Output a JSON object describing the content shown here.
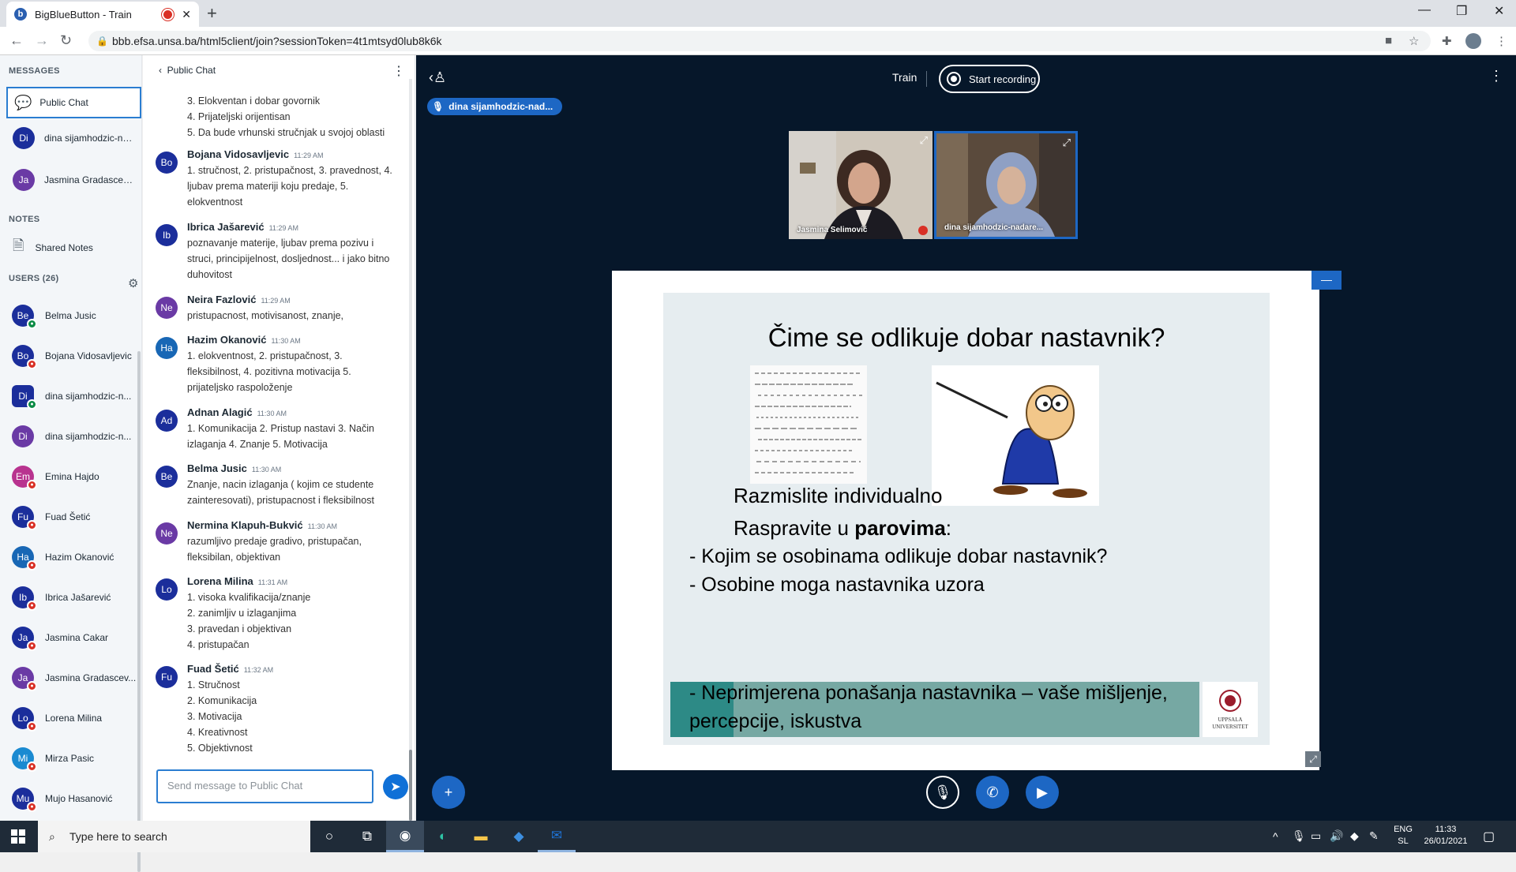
{
  "browser": {
    "tab_title": "BigBlueButton - Train",
    "tab_favicon": "b",
    "url": "bbb.efsa.unsa.ba/html5client/join?sessionToken=4t1mtsyd0lub8k6k"
  },
  "sidebar": {
    "messages_title": "MESSAGES",
    "public_chat": "Public Chat",
    "private_chats": [
      {
        "initials": "Di",
        "name": "dina sijamhodzic-na...",
        "color": "#1b2e9b"
      },
      {
        "initials": "Ja",
        "name": "Jasmina Gradascevic...",
        "color": "#6a3aa5"
      }
    ],
    "notes_title": "NOTES",
    "shared_notes": "Shared Notes",
    "users_title": "USERS (26)",
    "users": [
      {
        "initials": "Be",
        "name": "Belma Jusic",
        "color": "#1b2e9b",
        "mic": "on"
      },
      {
        "initials": "Bo",
        "name": "Bojana Vidosavljevic",
        "color": "#1b2e9b",
        "mic": "off"
      },
      {
        "initials": "Di",
        "name": "dina sijamhodzic-n...",
        "color": "#1b2e9b",
        "mic": "on"
      },
      {
        "initials": "Di",
        "name": "dina sijamhodzic-n...",
        "color": "#6a3aa5",
        "mic": "off"
      },
      {
        "initials": "Em",
        "name": "Emina Hajdo",
        "color": "#b8338f",
        "mic": "off"
      },
      {
        "initials": "Fu",
        "name": "Fuad Šetić",
        "color": "#1b2e9b",
        "mic": "off"
      },
      {
        "initials": "Ha",
        "name": "Hazim Okanović",
        "color": "#1867b5",
        "mic": "off"
      },
      {
        "initials": "Ib",
        "name": "Ibrica Jašarević",
        "color": "#1b2e9b",
        "mic": "off"
      },
      {
        "initials": "Ja",
        "name": "Jasmina Cakar",
        "color": "#1b2e9b",
        "mic": "off"
      },
      {
        "initials": "Ja",
        "name": "Jasmina Gradascev...",
        "color": "#6a3aa5",
        "mic": "off"
      },
      {
        "initials": "Lo",
        "name": "Lorena Milina",
        "color": "#1b2e9b",
        "mic": "off"
      },
      {
        "initials": "Mi",
        "name": "Mirza Pasic",
        "color": "#1a8ad1",
        "mic": "off"
      },
      {
        "initials": "Mu",
        "name": "Mujo Hasanović",
        "color": "#1b2e9b",
        "mic": "off"
      }
    ]
  },
  "chat": {
    "header": "Public Chat",
    "top_partial": "3. Elokventan i dobar govornik\n4. Prijateljski orijentisan\n5. Da bude vrhunski stručnjak u svojoj oblasti",
    "messages": [
      {
        "initials": "Bo",
        "color": "#1b2e9b",
        "name": "Bojana Vidosavljevic",
        "time": "11:29 AM",
        "text": "1. stručnost, 2. pristupačnost, 3. pravednost, 4.\nljubav prema materiji koju predaje, 5.\nelokventnost"
      },
      {
        "initials": "Ib",
        "color": "#1b2e9b",
        "name": "Ibrica Jašarević",
        "time": "11:29 AM",
        "text": "poznavanje materije, ljubav prema pozivu i\nstruci, principijelnost, dosljednost... i jako bitno\nduhovitost"
      },
      {
        "initials": "Ne",
        "color": "#6a3aa5",
        "name": "Neira Fazlović",
        "time": "11:29 AM",
        "text": "pristupacnost, motivisanost, znanje,"
      },
      {
        "initials": "Ha",
        "color": "#1867b5",
        "name": "Hazim Okanović",
        "time": "11:30 AM",
        "text": "1. elokventnost, 2. pristupačnost, 3.\nfleksibilnost, 4. pozitivna motivacija 5.\nprijateljsko raspoloženje"
      },
      {
        "initials": "Ad",
        "color": "#1b2e9b",
        "name": "Adnan Alagić",
        "time": "11:30 AM",
        "text": "1. Komunikacija 2. Pristup nastavi 3. Način\nizlaganja 4. Znanje 5. Motivacija"
      },
      {
        "initials": "Be",
        "color": "#1b2e9b",
        "name": "Belma Jusic",
        "time": "11:30 AM",
        "text": "Znanje, nacin izlaganja ( kojim ce studente\nzainteresovati), pristupacnost i fleksibilnost"
      },
      {
        "initials": "Ne",
        "color": "#6a3aa5",
        "name": "Nermina Klapuh-Bukvić",
        "time": "11:30 AM",
        "text": "razumljivo predaje gradivo, pristupačan,\nfleksibilan, objektivan"
      },
      {
        "initials": "Lo",
        "color": "#1b2e9b",
        "name": "Lorena Milina",
        "time": "11:31 AM",
        "text": "1. visoka kvalifikacija/znanje\n2. zanimljiv u izlaganjima\n3. pravedan i objektivan\n4. pristupačan"
      },
      {
        "initials": "Fu",
        "color": "#1b2e9b",
        "name": "Fuad Šetić",
        "time": "11:32 AM",
        "text": "1. Stručnost\n2. Komunikacija\n3. Motivacija\n4. Kreativnost\n5. Objektivnost"
      }
    ],
    "input_placeholder": "Send message to Public Chat"
  },
  "main": {
    "room_title": "Train",
    "record_label": "Start recording",
    "talking": "dina sijamhodzic-nad...",
    "videos": [
      {
        "name": "Jasmina Selimović"
      },
      {
        "name": "dina sijamhodzic-nadare..."
      }
    ],
    "slide": {
      "title": "Čime se odlikuje dobar nastavnik?",
      "line1": "Razmislite individualno",
      "line2_prefix": "Raspravite u ",
      "line2_bold": "parovima",
      "line2_suffix": ":",
      "bullet1": "- Kojim se osobinama odlikuje dobar nastavnik?",
      "bullet2": "- Osobine moga nastavnika uzora",
      "bullet3a": "- Neprimjerena ponašanja nastavnika – vaše mišljenje,",
      "bullet3b": "percepcije, iskustva",
      "logo_text": "UPPSALA UNIVERSITET"
    }
  },
  "taskbar": {
    "search_placeholder": "Type here to search",
    "lang_top": "ENG",
    "lang_bottom": "SL",
    "time": "11:33",
    "date": "26/01/2021"
  }
}
